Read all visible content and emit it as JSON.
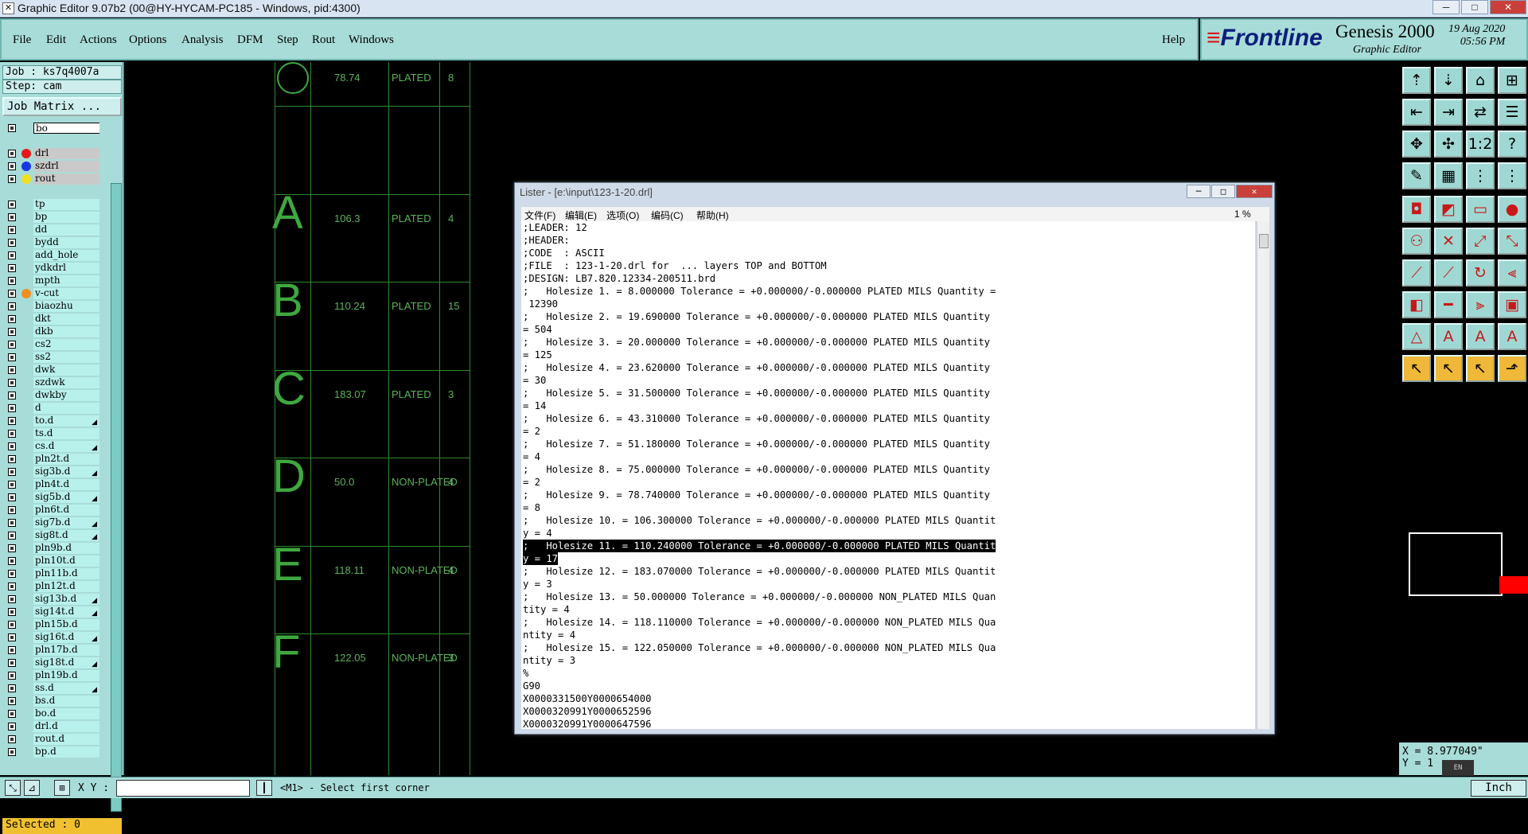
{
  "window": {
    "title": "Graphic Editor 9.07b2 (00@HY-HYCAM-PC185 - Windows, pid:4300)",
    "minimize": "─",
    "maximize": "□",
    "close": "✕"
  },
  "menu": {
    "items": [
      "File",
      "Edit",
      "Actions",
      "Options",
      "Analysis",
      "DFM",
      "Step",
      "Rout",
      "Windows"
    ],
    "help": "Help"
  },
  "logo": {
    "brand": "Frontline",
    "product": "Genesis 2000",
    "subtitle": "Graphic Editor",
    "date": "19 Aug 2020",
    "time": "05:56 PM"
  },
  "job": {
    "job": "Job : ks7q4007a",
    "step": "Step: cam",
    "matrix_button": "Job Matrix ..."
  },
  "layers": [
    {
      "name": "bo",
      "color": "",
      "style": "white",
      "arrow": false
    },
    {
      "name": "",
      "color": "",
      "style": "",
      "arrow": false
    },
    {
      "name": "drl",
      "color": "#e81818",
      "style": "gray",
      "arrow": false
    },
    {
      "name": "szdrl",
      "color": "#1838e8",
      "style": "gray",
      "arrow": false
    },
    {
      "name": "rout",
      "color": "#f0e020",
      "style": "gray",
      "arrow": false
    },
    {
      "name": "",
      "color": "",
      "style": "",
      "arrow": false
    },
    {
      "name": "tp",
      "color": "",
      "style": "",
      "arrow": false
    },
    {
      "name": "bp",
      "color": "",
      "style": "",
      "arrow": false
    },
    {
      "name": "dd",
      "color": "",
      "style": "",
      "arrow": false
    },
    {
      "name": "bydd",
      "color": "",
      "style": "",
      "arrow": false
    },
    {
      "name": "add_hole",
      "color": "",
      "style": "",
      "arrow": false
    },
    {
      "name": "ydkdrl",
      "color": "",
      "style": "",
      "arrow": false
    },
    {
      "name": "mpth",
      "color": "",
      "style": "",
      "arrow": false
    },
    {
      "name": "v-cut",
      "color": "#f09020",
      "style": "",
      "arrow": false
    },
    {
      "name": "biaozhu",
      "color": "",
      "style": "",
      "arrow": false
    },
    {
      "name": "dkt",
      "color": "",
      "style": "",
      "arrow": false
    },
    {
      "name": "dkb",
      "color": "",
      "style": "",
      "arrow": false
    },
    {
      "name": "cs2",
      "color": "",
      "style": "",
      "arrow": false
    },
    {
      "name": "ss2",
      "color": "",
      "style": "",
      "arrow": false
    },
    {
      "name": "dwk",
      "color": "",
      "style": "",
      "arrow": false
    },
    {
      "name": "szdwk",
      "color": "",
      "style": "",
      "arrow": false
    },
    {
      "name": "dwkby",
      "color": "",
      "style": "",
      "arrow": false
    },
    {
      "name": "d",
      "color": "",
      "style": "",
      "arrow": false
    },
    {
      "name": "to.d",
      "color": "",
      "style": "",
      "arrow": true
    },
    {
      "name": "ts.d",
      "color": "",
      "style": "",
      "arrow": false
    },
    {
      "name": "cs.d",
      "color": "",
      "style": "",
      "arrow": true
    },
    {
      "name": "pln2t.d",
      "color": "",
      "style": "",
      "arrow": false
    },
    {
      "name": "sig3b.d",
      "color": "",
      "style": "",
      "arrow": true
    },
    {
      "name": "pln4t.d",
      "color": "",
      "style": "",
      "arrow": false
    },
    {
      "name": "sig5b.d",
      "color": "",
      "style": "",
      "arrow": true
    },
    {
      "name": "pln6t.d",
      "color": "",
      "style": "",
      "arrow": false
    },
    {
      "name": "sig7b.d",
      "color": "",
      "style": "",
      "arrow": true
    },
    {
      "name": "sig8t.d",
      "color": "",
      "style": "",
      "arrow": true
    },
    {
      "name": "pln9b.d",
      "color": "",
      "style": "",
      "arrow": false
    },
    {
      "name": "pln10t.d",
      "color": "",
      "style": "",
      "arrow": false
    },
    {
      "name": "pln11b.d",
      "color": "",
      "style": "",
      "arrow": false
    },
    {
      "name": "pln12t.d",
      "color": "",
      "style": "",
      "arrow": false
    },
    {
      "name": "sig13b.d",
      "color": "",
      "style": "",
      "arrow": true
    },
    {
      "name": "sig14t.d",
      "color": "",
      "style": "",
      "arrow": true
    },
    {
      "name": "pln15b.d",
      "color": "",
      "style": "",
      "arrow": false
    },
    {
      "name": "sig16t.d",
      "color": "",
      "style": "",
      "arrow": true
    },
    {
      "name": "pln17b.d",
      "color": "",
      "style": "",
      "arrow": false
    },
    {
      "name": "sig18t.d",
      "color": "",
      "style": "",
      "arrow": true
    },
    {
      "name": "pln19b.d",
      "color": "",
      "style": "",
      "arrow": false
    },
    {
      "name": "ss.d",
      "color": "",
      "style": "",
      "arrow": true
    },
    {
      "name": "bs.d",
      "color": "",
      "style": "",
      "arrow": false
    },
    {
      "name": "bo.d",
      "color": "",
      "style": "",
      "arrow": false
    },
    {
      "name": "drl.d",
      "color": "",
      "style": "",
      "arrow": false
    },
    {
      "name": "rout.d",
      "color": "",
      "style": "",
      "arrow": false
    },
    {
      "name": "bp.d",
      "color": "",
      "style": "",
      "arrow": false
    }
  ],
  "selected": "Selected : 0",
  "drill_table": [
    {
      "symbol": "",
      "size": "78.74",
      "type": "PLATED",
      "count": "8"
    },
    {
      "symbol": "A",
      "size": "106.3",
      "type": "PLATED",
      "count": "4"
    },
    {
      "symbol": "B",
      "size": "110.24",
      "type": "PLATED",
      "count": "15"
    },
    {
      "symbol": "C",
      "size": "183.07",
      "type": "PLATED",
      "count": "3"
    },
    {
      "symbol": "D",
      "size": "50.0",
      "type": "NON-PLATED",
      "count": "4"
    },
    {
      "symbol": "E",
      "size": "118.11",
      "type": "NON-PLATED",
      "count": "4"
    },
    {
      "symbol": "F",
      "size": "122.05",
      "type": "NON-PLATED",
      "count": "3"
    }
  ],
  "lister": {
    "title": "Lister - [e:\\input\\123-1-20.drl]",
    "menu": [
      "文件(F)",
      "编辑(E)",
      "选项(O)",
      "编码(C)",
      "帮助(H)"
    ],
    "percent": "1 %",
    "lines": [
      ";LEADER: 12",
      ";HEADER:",
      ";CODE  : ASCII",
      ";FILE  : 123-1-20.drl for  ... layers TOP and BOTTOM",
      ";DESIGN: LB7.820.12334-200511.brd",
      ";   Holesize 1. = 8.000000 Tolerance = +0.000000/-0.000000 PLATED MILS Quantity =",
      " 12390",
      ";   Holesize 2. = 19.690000 Tolerance = +0.000000/-0.000000 PLATED MILS Quantity",
      "= 504",
      ";   Holesize 3. = 20.000000 Tolerance = +0.000000/-0.000000 PLATED MILS Quantity",
      "= 125",
      ";   Holesize 4. = 23.620000 Tolerance = +0.000000/-0.000000 PLATED MILS Quantity",
      "= 30",
      ";   Holesize 5. = 31.500000 Tolerance = +0.000000/-0.000000 PLATED MILS Quantity",
      "= 14",
      ";   Holesize 6. = 43.310000 Tolerance = +0.000000/-0.000000 PLATED MILS Quantity",
      "= 2",
      ";   Holesize 7. = 51.180000 Tolerance = +0.000000/-0.000000 PLATED MILS Quantity",
      "= 4",
      ";   Holesize 8. = 75.000000 Tolerance = +0.000000/-0.000000 PLATED MILS Quantity",
      "= 2",
      ";   Holesize 9. = 78.740000 Tolerance = +0.000000/-0.000000 PLATED MILS Quantity",
      "= 8",
      ";   Holesize 10. = 106.300000 Tolerance = +0.000000/-0.000000 PLATED MILS Quantit",
      "y = 4",
      ";   Holesize 11. = 110.240000 Tolerance = +0.000000/-0.000000 PLATED MILS Quantit",
      "y = 17",
      ";   Holesize 12. = 183.070000 Tolerance = +0.000000/-0.000000 PLATED MILS Quantit",
      "y = 3",
      ";   Holesize 13. = 50.000000 Tolerance = +0.000000/-0.000000 NON_PLATED MILS Quan",
      "tity = 4",
      ";   Holesize 14. = 118.110000 Tolerance = +0.000000/-0.000000 NON_PLATED MILS Qua",
      "ntity = 4",
      ";   Holesize 15. = 122.050000 Tolerance = +0.000000/-0.000000 NON_PLATED MILS Qua",
      "ntity = 3",
      "%",
      "G90",
      "X0000331500Y0000654000",
      "X0000320991Y0000652596",
      "X0000320991Y0000647596"
    ],
    "highlighted": [
      25,
      26
    ]
  },
  "tools": [
    "⇡",
    "⇣",
    "⌂",
    "⊞",
    "⇤",
    "⇥",
    "⇄",
    "☰",
    "✥",
    "✣",
    "1:2",
    "?",
    "✎",
    "▦",
    "⋮",
    "⋮",
    "◘",
    "◩",
    "▭",
    "●",
    "⚇",
    "✕",
    "⤢",
    "⤡",
    "⟋",
    "⟋",
    "↻",
    "⫷",
    "◧",
    "━",
    "⫸",
    "▣",
    "△",
    "A",
    "A",
    "A",
    "↖",
    "↖",
    "↖",
    "⬏"
  ],
  "coords": {
    "x": "X = 8.977049\"",
    "y": "Y = 1"
  },
  "ime": "EN",
  "status": {
    "xy_label": "X Y :",
    "prompt": "<M1> - Select first corner",
    "units": "Inch"
  }
}
